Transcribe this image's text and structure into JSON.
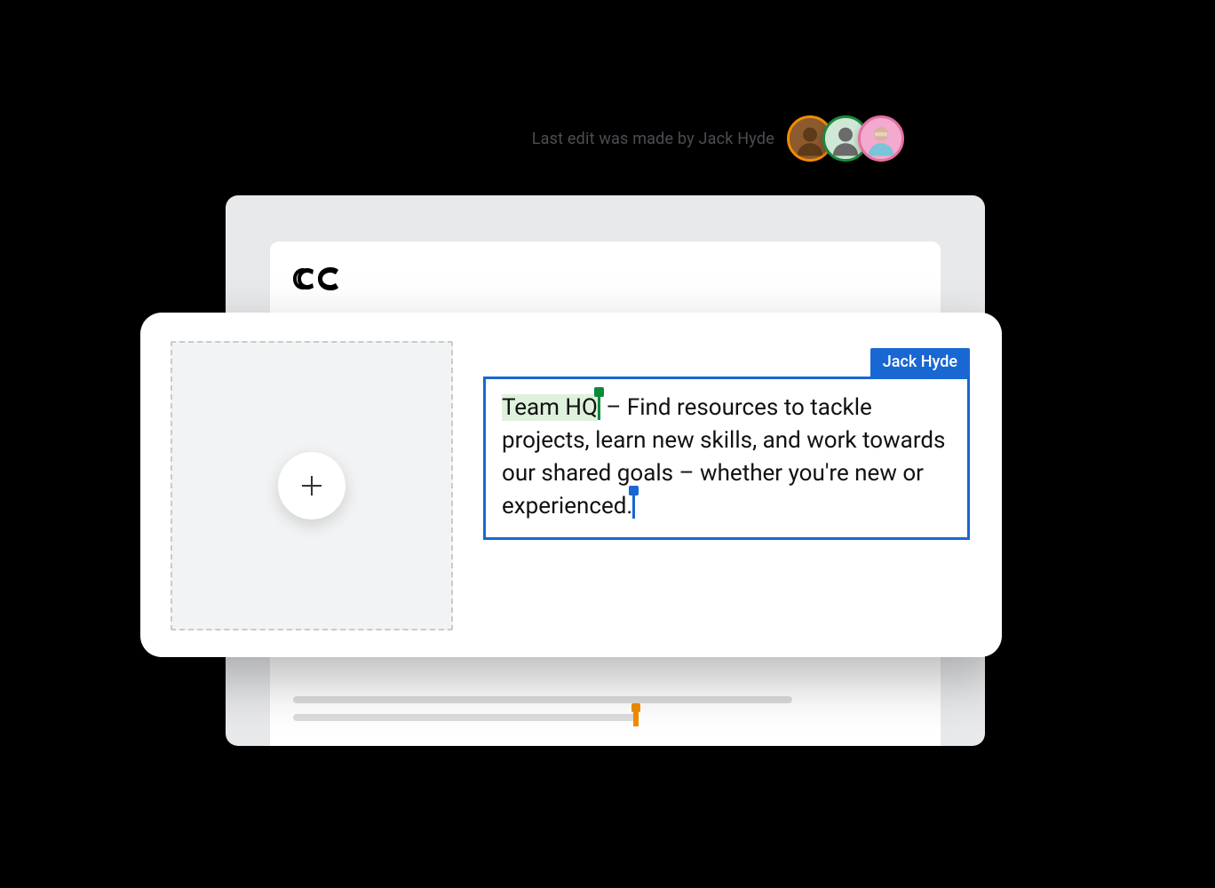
{
  "top": {
    "last_edit": "Last edit was made by Jack Hyde",
    "avatars": [
      {
        "ring": "#f28c00",
        "bg": "#8c5a2d"
      },
      {
        "ring": "#1b8a3e",
        "bg": "#cfe8d6"
      },
      {
        "ring": "#e56fa1",
        "bg": "#f4a9cf"
      }
    ]
  },
  "editor": {
    "user_label": "Jack Hyde",
    "highlight": "Team HQ",
    "body": " – Find resources to tackle projects, learn new skills, and work towards our shared goals – whether you're new or experienced."
  },
  "icons": {
    "plus": "plus-icon",
    "logo": "brand-logo"
  }
}
